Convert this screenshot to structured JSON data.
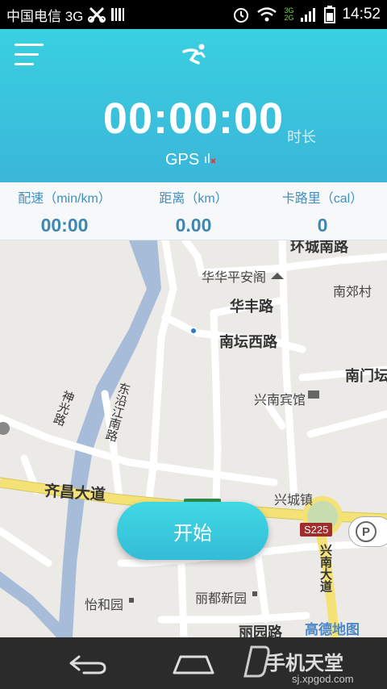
{
  "status_bar": {
    "carrier": "中国电信 3G",
    "time": "14:52",
    "net_labels": [
      "3G",
      "2G"
    ]
  },
  "header": {
    "timer": "00:00:00",
    "timer_unit": "时长",
    "gps_label": "GPS"
  },
  "stats": [
    {
      "label": "配速（min/km）",
      "value": "00:00"
    },
    {
      "label": "距离（km）",
      "value": "0.00"
    },
    {
      "label": "卡路里（cal）",
      "value": "0"
    }
  ],
  "map": {
    "labels": {
      "huancheng": "环城南路",
      "huahuapinganyuan": "华华平安阁",
      "nanjiaocun": "南郊村",
      "huafeng": "华丰路",
      "nantanxi": "南坛西路",
      "nanmen": "南门坛",
      "xingnan_hotel": "兴南宾馆",
      "shenguang": "神光路",
      "dongyanjiang": "东沿江南路",
      "qichang": "齐昌大道",
      "xingcheng": "兴城镇",
      "xingnan_ave": "兴南大道",
      "lidu": "丽都新园",
      "yihe": "怡和园",
      "liyuan": "丽园路",
      "s225": "S225",
      "parking": "P",
      "amap": "高德地图"
    }
  },
  "start_button": "开始",
  "watermark": {
    "title": "手机天堂",
    "url": "sj.xpgod.com"
  },
  "colors": {
    "header_top": "#39d0e0",
    "header_bottom": "#3ab6d9",
    "stat_text": "#3e87b4",
    "start_button": "#38c6dc",
    "nav_bar": "#2b2b2b"
  }
}
